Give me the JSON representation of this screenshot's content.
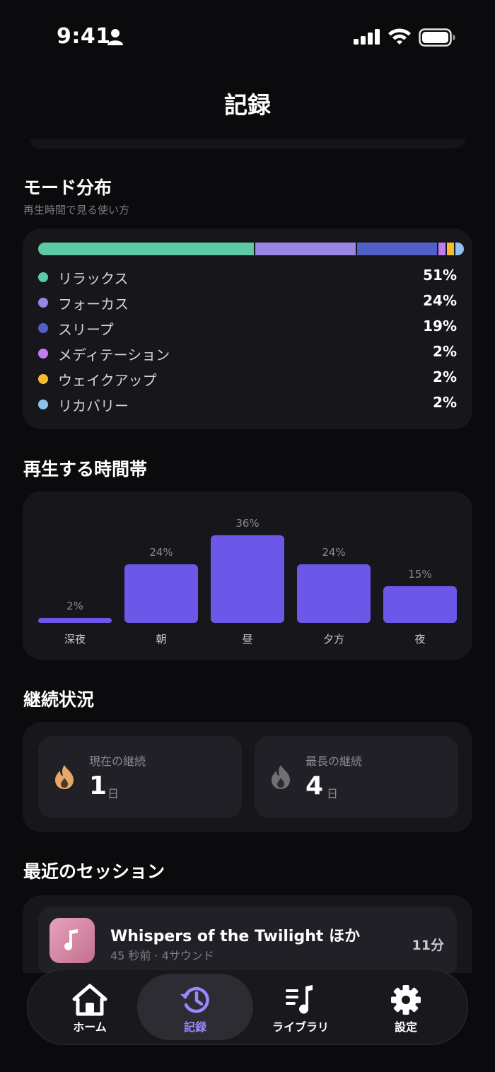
{
  "status_bar": {
    "time": "9:41"
  },
  "header": {
    "title": "記録"
  },
  "mode_distribution": {
    "title": "モード分布",
    "subtitle": "再生時間で見る使い方",
    "modes": [
      {
        "name": "リラックス",
        "percent_label": "51%",
        "percent": 51,
        "color": "#5ccaa3"
      },
      {
        "name": "フォーカス",
        "percent_label": "24%",
        "percent": 24,
        "color": "#9a85e5"
      },
      {
        "name": "スリープ",
        "percent_label": "19%",
        "percent": 19,
        "color": "#5160c4"
      },
      {
        "name": "メディテーション",
        "percent_label": "2%",
        "percent": 2,
        "color": "#c07df0"
      },
      {
        "name": "ウェイクアップ",
        "percent_label": "2%",
        "percent": 2,
        "color": "#f4bd2e"
      },
      {
        "name": "リカバリー",
        "percent_label": "2%",
        "percent": 2,
        "color": "#8ec2ee"
      }
    ]
  },
  "time_of_day": {
    "title": "再生する時間帯",
    "bar_color": "#6c58e8",
    "slots": [
      {
        "label": "深夜",
        "value_label": "2%",
        "value": 2
      },
      {
        "label": "朝",
        "value_label": "24%",
        "value": 24
      },
      {
        "label": "昼",
        "value_label": "36%",
        "value": 36
      },
      {
        "label": "夕方",
        "value_label": "24%",
        "value": 24
      },
      {
        "label": "夜",
        "value_label": "15%",
        "value": 15
      }
    ]
  },
  "streak": {
    "title": "継続状況",
    "current": {
      "label": "現在の継続",
      "value": "1",
      "unit": "日",
      "icon": "flame-icon",
      "color": "#e5a867"
    },
    "longest": {
      "label": "最長の継続",
      "value": "4",
      "unit": "日",
      "icon": "flame-icon",
      "color": "#6f6f76"
    }
  },
  "recent_sessions": {
    "title": "最近のセッション",
    "items": [
      {
        "title": "Whispers of the Twilight ほか",
        "meta": "45 秒前 · 4サウンド",
        "duration": "11分",
        "icon": "music-note-icon"
      }
    ]
  },
  "tab_bar": {
    "active_color": "#9b87ff",
    "tabs": [
      {
        "label": "ホーム",
        "icon": "home-icon",
        "active": false
      },
      {
        "label": "記録",
        "icon": "history-icon",
        "active": true
      },
      {
        "label": "ライブラリ",
        "icon": "library-icon",
        "active": false
      },
      {
        "label": "設定",
        "icon": "gear-icon",
        "active": false
      }
    ]
  }
}
